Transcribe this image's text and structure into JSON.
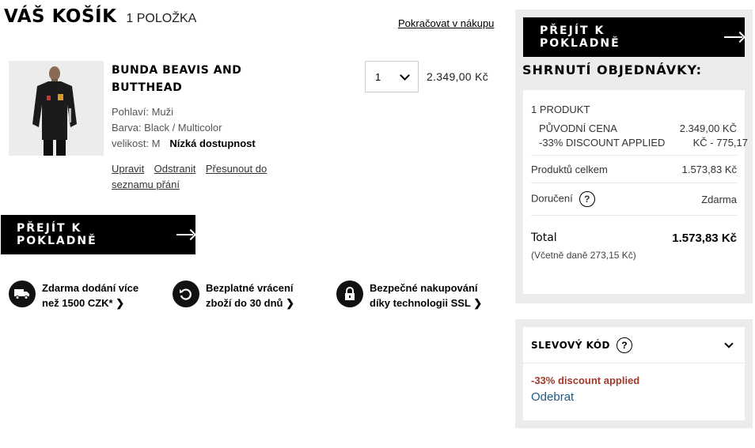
{
  "cart": {
    "title": "VÁŠ KOŠÍK",
    "count": "1 POLOŽKA",
    "continue_link": "Pokračovat v nákupu"
  },
  "item": {
    "name_line1": "BUNDA BEAVIS AND",
    "name_line2": "BUTTHEAD",
    "gender": "Pohlaví: Muži",
    "color": "Barva: Black / Multicolor",
    "size": "velikost: M",
    "availability": "Nízká dostupnost",
    "quantity": "1",
    "price": "2.349,00 Kč",
    "edit": "Upravit",
    "remove": "Odstranit",
    "move_line1": "Přesunout do",
    "move_line2": "seznamu přání"
  },
  "checkout_button": "PŘEJÍT K POKLADNĚ",
  "features": [
    {
      "icon": "truck-icon",
      "line1": "Zdarma dodání více",
      "line2": "než 1500 CZK*"
    },
    {
      "icon": "return-icon",
      "line1": "Bezplatné vrácení",
      "line2": "zboží do 30 dnů"
    },
    {
      "icon": "lock-icon",
      "line1": "Bezpečné nakupování",
      "line2": "díky technologii SSL"
    }
  ],
  "summary": {
    "title": "SHRNUTÍ OBJEDNÁVKY:",
    "products_count": "1 PRODUKT",
    "original_label": "PŮVODNÍ CENA",
    "original_value": "2.349,00 KČ",
    "discount_label": "-33% DISCOUNT APPLIED",
    "discount_value": "KČ - 775,17",
    "subtotal_label": "Produktů celkem",
    "subtotal_value": "1.573,83 Kč",
    "delivery_label": "Doručení",
    "delivery_value": "Zdarma",
    "total_label": "Total",
    "total_value": "1.573,83 Kč",
    "vat": "(Včetně daně 273,15 Kč)"
  },
  "promo": {
    "title": "SLEVOVÝ KÓD",
    "applied": "-33% discount applied",
    "remove": "Odebrat"
  },
  "colors": {
    "accent_red": "#a0392a",
    "link_blue": "#1d5a84",
    "panel_bg": "#ececec"
  }
}
